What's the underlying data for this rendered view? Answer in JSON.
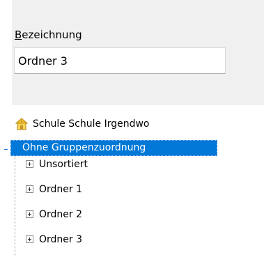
{
  "form": {
    "label_mnemonic": "B",
    "label_rest": "ezeichnung",
    "value": "Ordner 3"
  },
  "tree": {
    "root": {
      "label": "Schule Schule Irgendwo",
      "icon": "school-house-icon"
    },
    "group": {
      "label": "Ohne Gruppenzuordnung",
      "expanded": true
    },
    "children": [
      {
        "label": "Unsortiert"
      },
      {
        "label": "Ordner 1"
      },
      {
        "label": "Ordner 2"
      },
      {
        "label": "Ordner 3"
      }
    ]
  },
  "colors": {
    "panel_bg": "#f0f0f0",
    "selection": "#0078d7",
    "selection_text": "#ffffff"
  }
}
